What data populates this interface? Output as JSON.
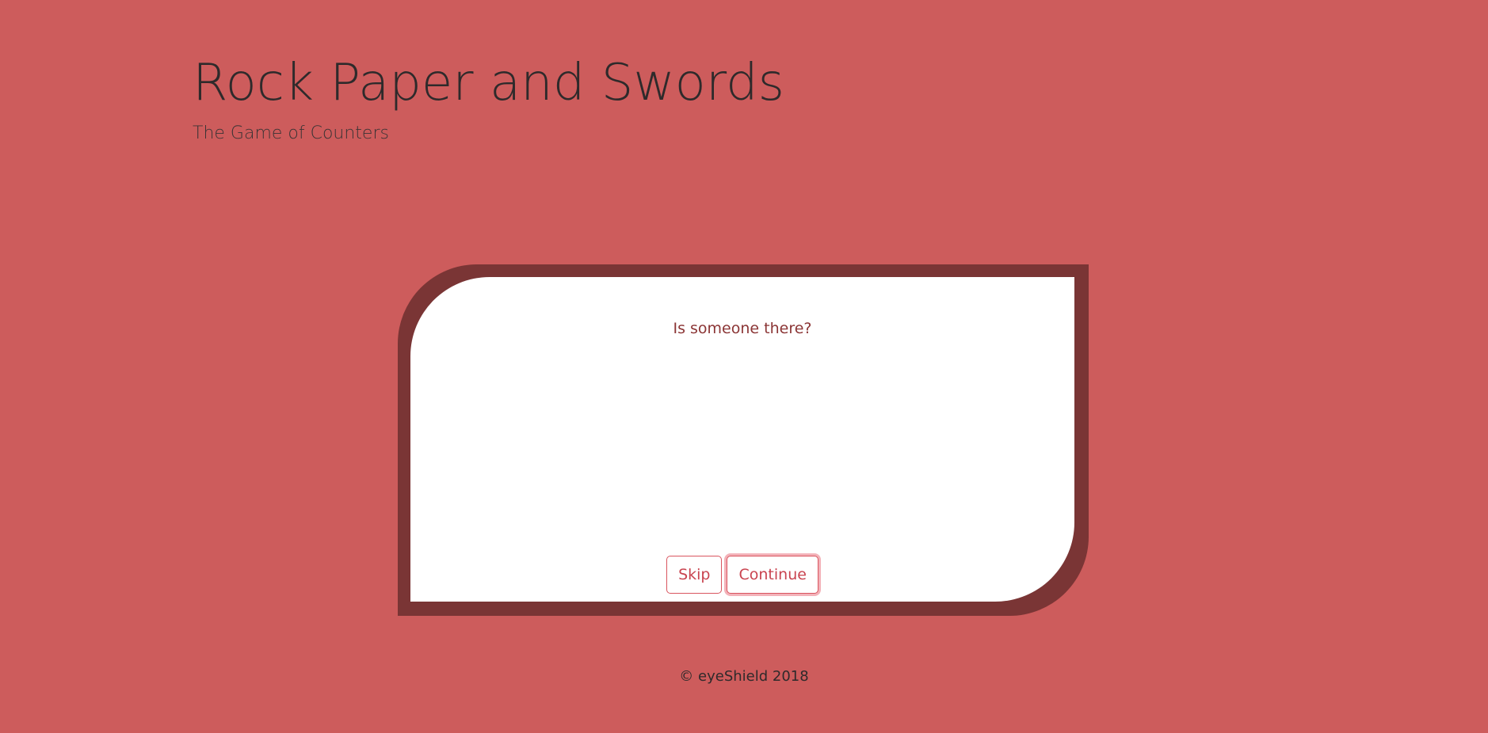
{
  "header": {
    "title": "Rock Paper and Swords",
    "subtitle": "The Game of Counters"
  },
  "dialog": {
    "message": "Is someone there?",
    "skip_label": "Skip",
    "continue_label": "Continue"
  },
  "footer": {
    "copyright": "© eyeShield 2018"
  },
  "colors": {
    "background": "#cd5c5c",
    "card": "#ffffff",
    "card_shadow": "#7a3535",
    "accent": "#c94450"
  }
}
